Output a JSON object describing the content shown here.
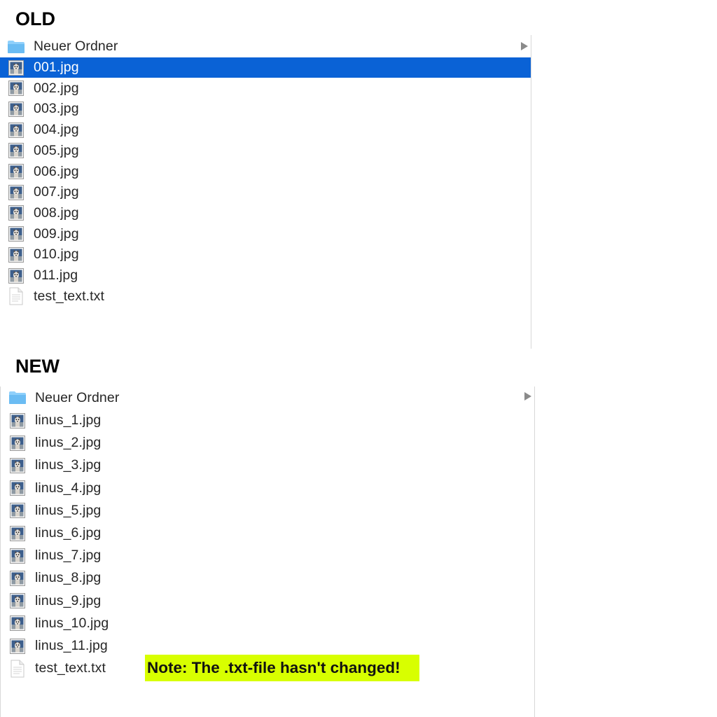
{
  "old": {
    "heading": "OLD",
    "folder": {
      "name": "Neuer Ordner",
      "icon": "folder-icon"
    },
    "files": [
      {
        "name": "001.jpg",
        "icon": "image-icon",
        "selected": true
      },
      {
        "name": "002.jpg",
        "icon": "image-icon"
      },
      {
        "name": "003.jpg",
        "icon": "image-icon"
      },
      {
        "name": "004.jpg",
        "icon": "image-icon"
      },
      {
        "name": "005.jpg",
        "icon": "image-icon"
      },
      {
        "name": "006.jpg",
        "icon": "image-icon"
      },
      {
        "name": "007.jpg",
        "icon": "image-icon"
      },
      {
        "name": "008.jpg",
        "icon": "image-icon"
      },
      {
        "name": "009.jpg",
        "icon": "image-icon"
      },
      {
        "name": "010.jpg",
        "icon": "image-icon"
      },
      {
        "name": "011.jpg",
        "icon": "image-icon"
      },
      {
        "name": "test_text.txt",
        "icon": "document-icon"
      }
    ]
  },
  "new": {
    "heading": "NEW",
    "folder": {
      "name": "Neuer Ordner",
      "icon": "folder-icon"
    },
    "files": [
      {
        "name": "linus_1.jpg",
        "icon": "image-icon"
      },
      {
        "name": "linus_2.jpg",
        "icon": "image-icon"
      },
      {
        "name": "linus_3.jpg",
        "icon": "image-icon"
      },
      {
        "name": "linus_4.jpg",
        "icon": "image-icon"
      },
      {
        "name": "linus_5.jpg",
        "icon": "image-icon"
      },
      {
        "name": "linus_6.jpg",
        "icon": "image-icon"
      },
      {
        "name": "linus_7.jpg",
        "icon": "image-icon"
      },
      {
        "name": "linus_8.jpg",
        "icon": "image-icon"
      },
      {
        "name": "linus_9.jpg",
        "icon": "image-icon"
      },
      {
        "name": "linus_10.jpg",
        "icon": "image-icon"
      },
      {
        "name": "linus_11.jpg",
        "icon": "image-icon"
      },
      {
        "name": "test_text.txt",
        "icon": "document-icon"
      }
    ]
  },
  "note": {
    "text": "Note: The .txt-file hasn't changed!"
  },
  "colors": {
    "selection": "#0a62d6",
    "folder": "#7cc4f5",
    "note_highlight": "#d8ff00"
  }
}
